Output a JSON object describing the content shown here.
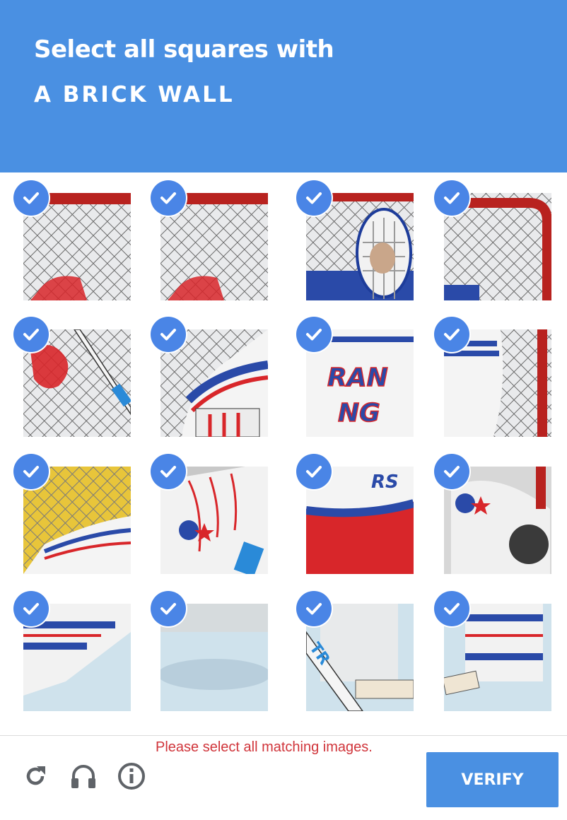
{
  "header": {
    "line1": "Select all squares with",
    "line2": "A BRICK WALL"
  },
  "grid": {
    "rows": 4,
    "cols": 4,
    "tiles": [
      {
        "row": 1,
        "col": 1,
        "selected": true,
        "depicts": "net"
      },
      {
        "row": 1,
        "col": 2,
        "selected": true,
        "depicts": "net"
      },
      {
        "row": 1,
        "col": 3,
        "selected": true,
        "depicts": "goalie-mask"
      },
      {
        "row": 1,
        "col": 4,
        "selected": true,
        "depicts": "goal-post"
      },
      {
        "row": 2,
        "col": 1,
        "selected": true,
        "depicts": "stick"
      },
      {
        "row": 2,
        "col": 2,
        "selected": true,
        "depicts": "jersey-arm"
      },
      {
        "row": 2,
        "col": 3,
        "selected": true,
        "depicts": "jersey"
      },
      {
        "row": 2,
        "col": 4,
        "selected": true,
        "depicts": "jersey-post"
      },
      {
        "row": 3,
        "col": 1,
        "selected": true,
        "depicts": "net-yellow"
      },
      {
        "row": 3,
        "col": 2,
        "selected": true,
        "depicts": "blocker-pad"
      },
      {
        "row": 3,
        "col": 3,
        "selected": true,
        "depicts": "jersey-bottom"
      },
      {
        "row": 3,
        "col": 4,
        "selected": true,
        "depicts": "glove"
      },
      {
        "row": 4,
        "col": 1,
        "selected": true,
        "depicts": "pad"
      },
      {
        "row": 4,
        "col": 2,
        "selected": true,
        "depicts": "ice"
      },
      {
        "row": 4,
        "col": 3,
        "selected": true,
        "depicts": "stick-blade"
      },
      {
        "row": 4,
        "col": 4,
        "selected": true,
        "depicts": "pad-ice"
      }
    ]
  },
  "footer": {
    "error": "Please select all matching images.",
    "verify_label": "VERIFY",
    "icons": [
      "refresh-icon",
      "headphones-icon",
      "info-icon"
    ]
  },
  "colors": {
    "header_bg": "#4a90e2",
    "check_bg": "#4a85e6",
    "error_text": "#d0343a",
    "verify_bg": "#4a90e2"
  }
}
